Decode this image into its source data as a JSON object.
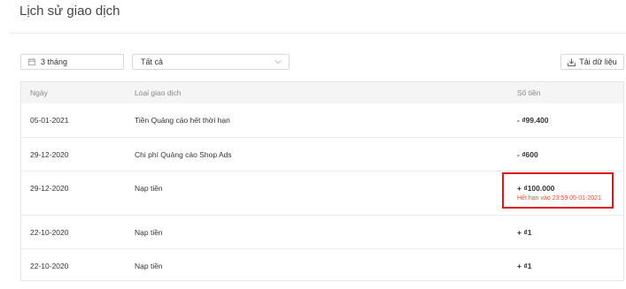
{
  "page": {
    "title": "Lịch sử giao dịch"
  },
  "filters": {
    "date_range": "3 tháng",
    "transaction_type": "Tất cả",
    "download_label": "Tải dữ liệu"
  },
  "table": {
    "columns": [
      "Ngày",
      "Loại giao dịch",
      "Số tiền"
    ],
    "rows": [
      {
        "date": "05-01-2021",
        "type": "Tiền Quảng cáo hết thời hạn",
        "amount": "- ₫99.400",
        "note": ""
      },
      {
        "date": "29-12-2020",
        "type": "Chi phí Quảng cáo Shop Ads",
        "amount": "- ₫600",
        "note": ""
      },
      {
        "date": "29-12-2020",
        "type": "Nạp tiền",
        "amount": "+ ₫100.000",
        "note": "Hết hạn vào 23:59 05-01-2021"
      },
      {
        "date": "22-10-2020",
        "type": "Nạp tiền",
        "amount": "+ ₫1",
        "note": ""
      },
      {
        "date": "22-10-2020",
        "type": "Nạp tiền",
        "amount": "+ ₫1",
        "note": ""
      }
    ]
  },
  "colors": {
    "highlight": "#e3141e",
    "expire_note": "#ee4d2d"
  }
}
